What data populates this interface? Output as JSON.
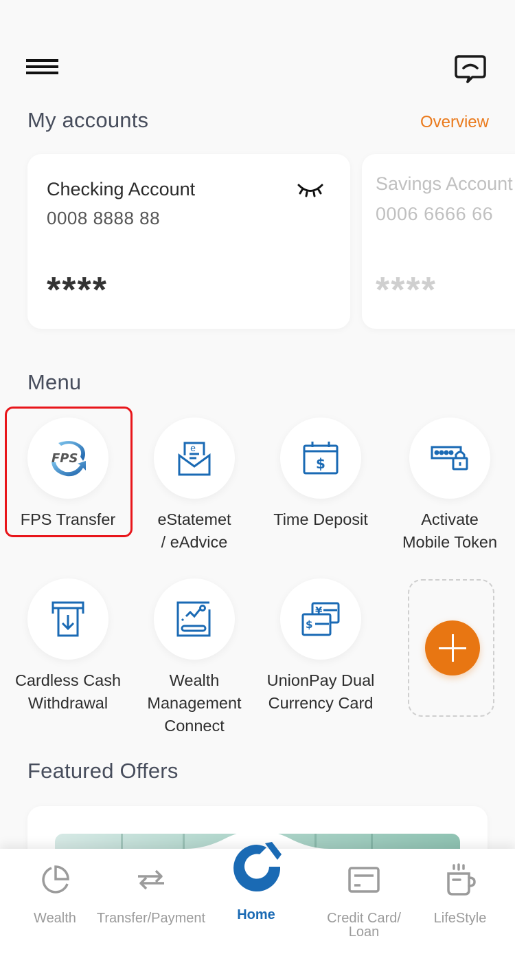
{
  "header": {
    "menu_icon": "hamburger-icon",
    "chat_icon": "chat-bubble-icon"
  },
  "accounts": {
    "title": "My accounts",
    "overview_label": "Overview",
    "overview_color": "#ea7a1c",
    "cards": [
      {
        "name": "Checking Account",
        "number": "0008 8888 88",
        "balance": "****",
        "visibility_icon": "eye-closed-icon",
        "active": true
      },
      {
        "name": "Savings Account",
        "number": "0006 6666 66",
        "balance": "****",
        "active": false
      }
    ]
  },
  "menu": {
    "title": "Menu",
    "items": [
      {
        "label": "FPS Transfer",
        "icon": "fps-logo-icon",
        "highlighted": true
      },
      {
        "label": "eStatemet\n/ eAdvice",
        "icon": "estatement-envelope-icon"
      },
      {
        "label": "Time Deposit",
        "icon": "calendar-dollar-icon"
      },
      {
        "label": "Activate\nMobile Token",
        "icon": "password-lock-icon"
      },
      {
        "label": "Cardless Cash\nWithdrawal",
        "icon": "atm-withdrawal-icon"
      },
      {
        "label": "Wealth\nManagement\nConnect",
        "icon": "wealth-chart-icon"
      },
      {
        "label": "UnionPay Dual\nCurrency Card",
        "icon": "dual-currency-card-icon"
      }
    ],
    "add_button_icon": "plus-icon",
    "highlight_color": "#e8161b",
    "icon_color": "#1a6ab4",
    "add_color": "#e87612"
  },
  "featured": {
    "title": "Featured Offers"
  },
  "tabbar": {
    "active_color": "#1a6ab4",
    "inactive_color": "#9b9b9b",
    "tabs": [
      {
        "label": "Wealth",
        "icon": "pie-chart-icon",
        "active": false
      },
      {
        "label": "Transfer/Payment",
        "icon": "transfer-arrows-icon",
        "active": false
      },
      {
        "label": "Home",
        "icon": "bank-logo-icon",
        "active": true
      },
      {
        "label": "Credit Card/\nLoan",
        "icon": "credit-card-icon",
        "active": false
      },
      {
        "label": "LifeStyle",
        "icon": "coffee-cup-icon",
        "active": false
      }
    ]
  }
}
